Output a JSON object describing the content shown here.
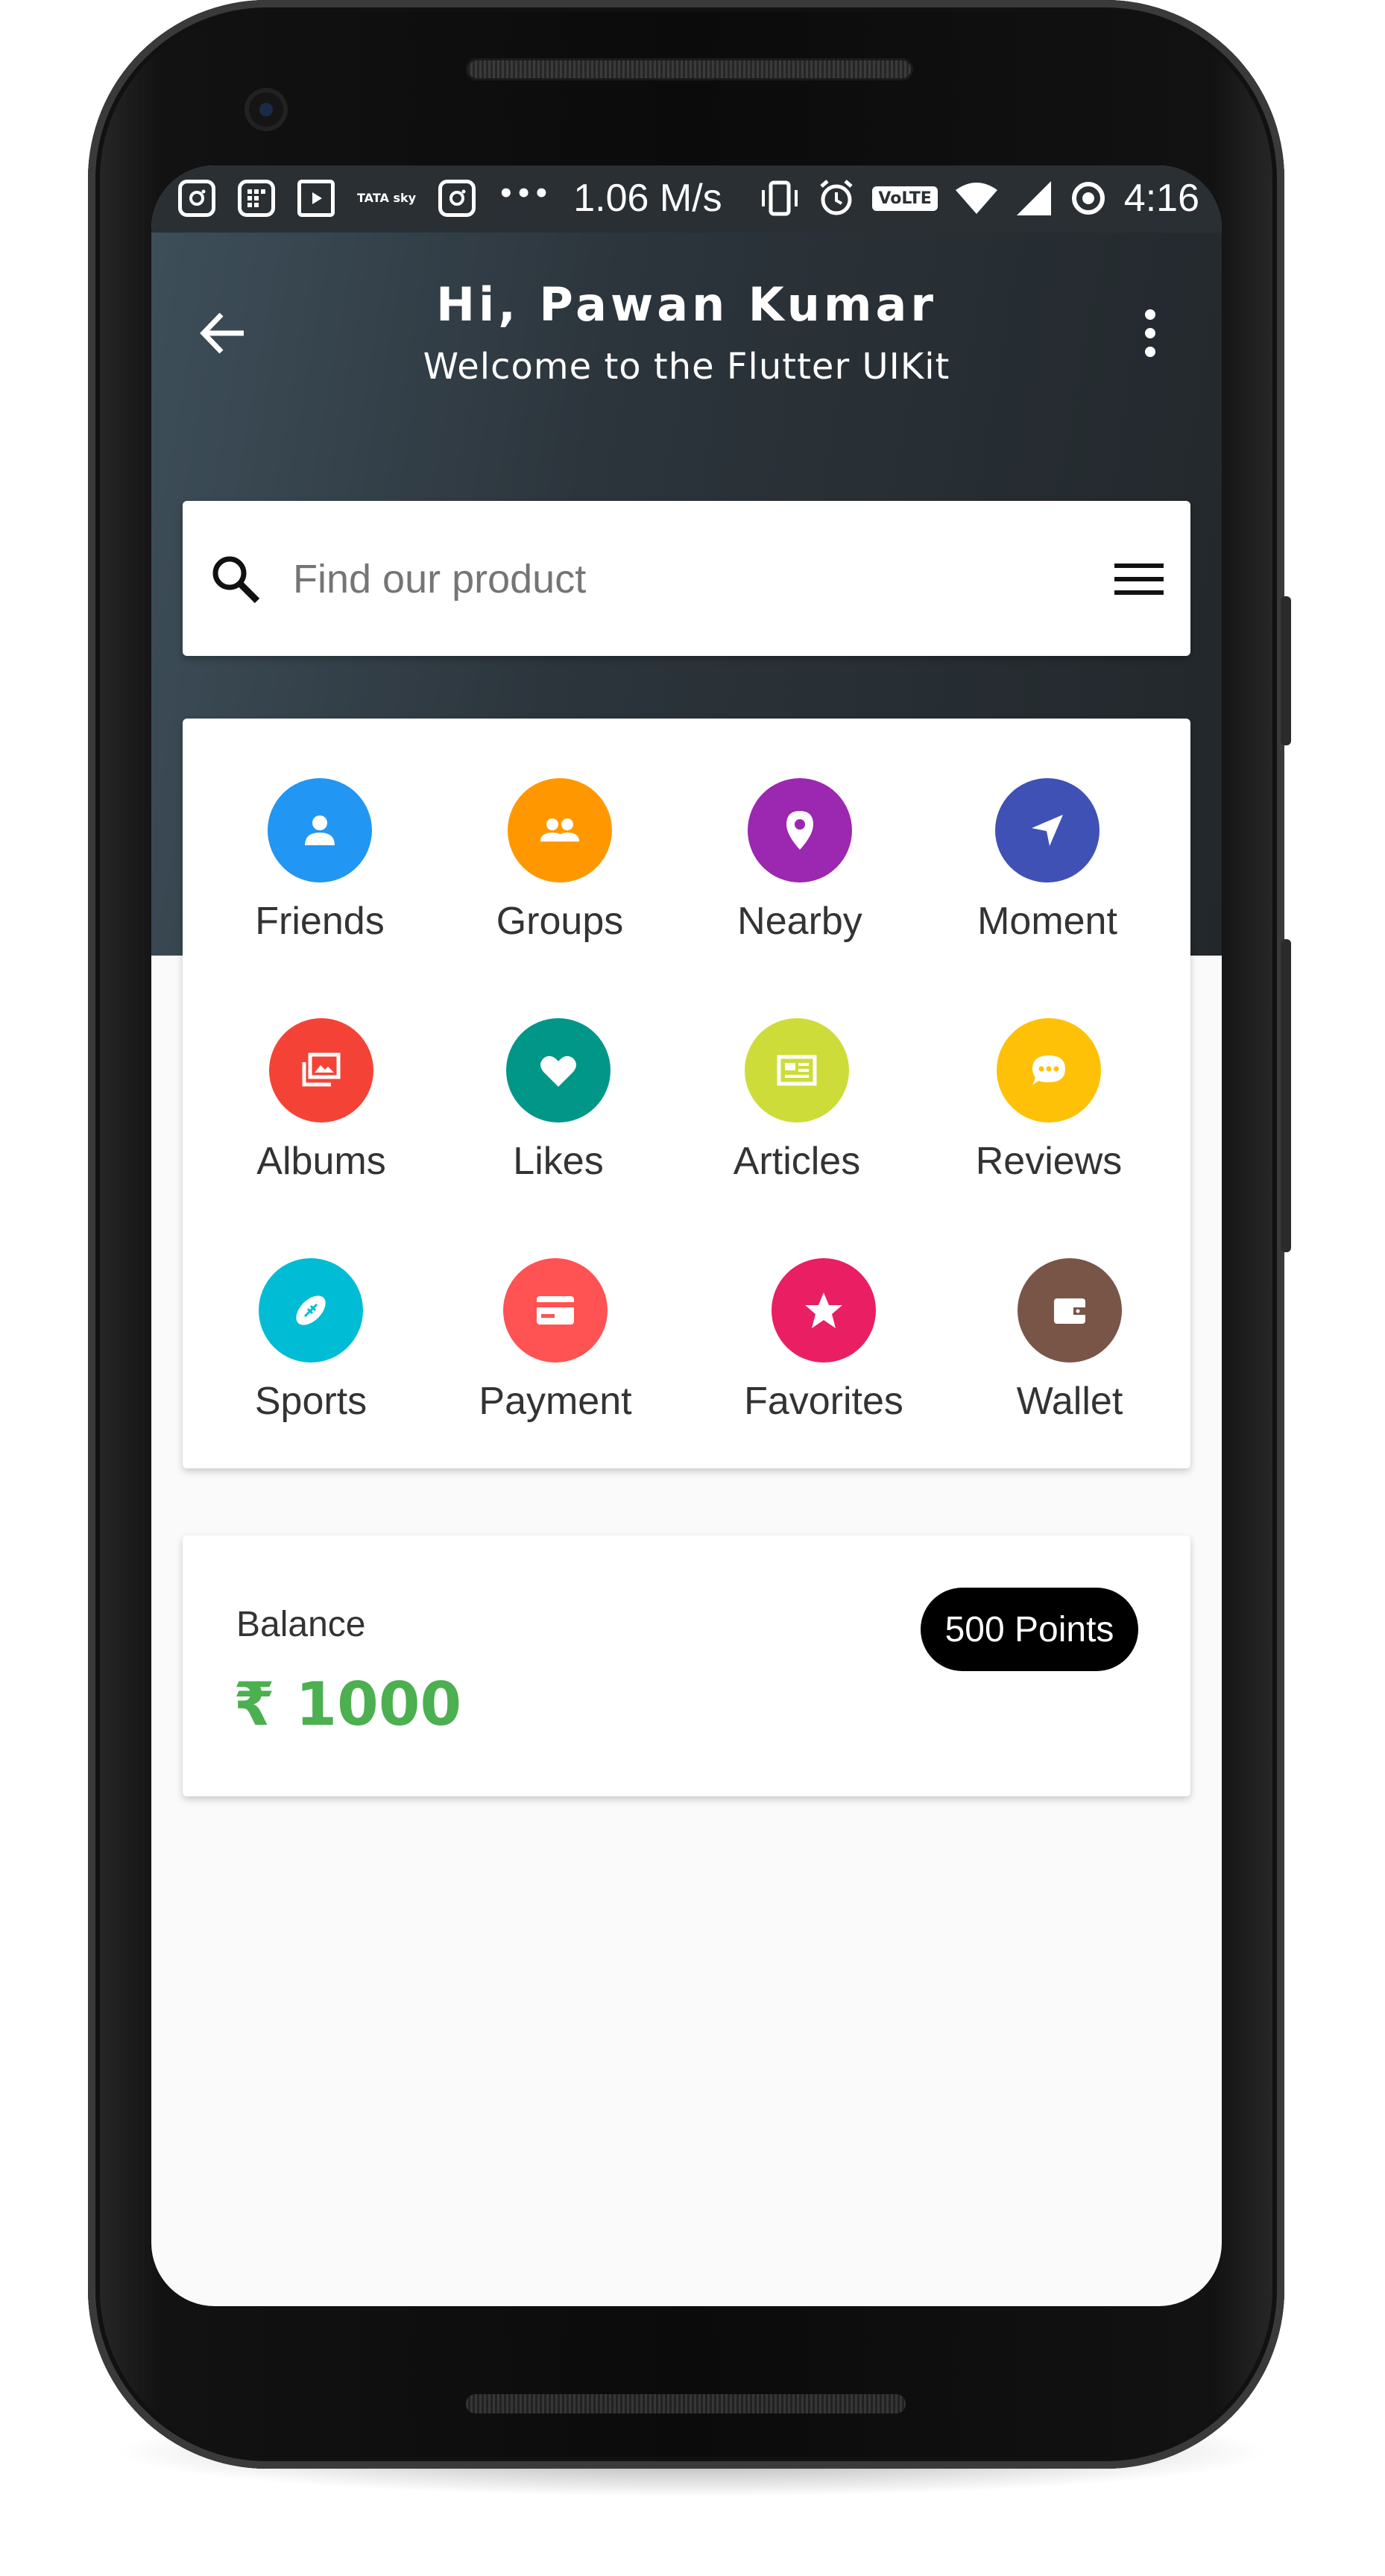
{
  "status_bar": {
    "speed": "1.06 M/s",
    "time": "4:16",
    "network_badge": "VoLTE",
    "provider_badge": "TATA sky",
    "icons": [
      "instagram-icon",
      "grid-app-icon",
      "tv-icon",
      "tata-sky-icon",
      "instagram-icon",
      "more-dots-icon",
      "vibrate-icon",
      "alarm-icon",
      "volte-icon",
      "wifi-icon",
      "signal-icon",
      "sync-icon"
    ]
  },
  "app_bar": {
    "title": "Hi, Pawan Kumar",
    "subtitle": "Welcome to the Flutter UIKit"
  },
  "search": {
    "placeholder": "Find our product"
  },
  "grid": {
    "items": [
      {
        "label": "Friends",
        "color": "#2196f3",
        "icon": "person-icon"
      },
      {
        "label": "Groups",
        "color": "#ff9800",
        "icon": "group-icon"
      },
      {
        "label": "Nearby",
        "color": "#9c27b0",
        "icon": "location-pin-icon"
      },
      {
        "label": "Moment",
        "color": "#3f51b5",
        "icon": "navigation-arrow-icon"
      },
      {
        "label": "Albums",
        "color": "#f44336",
        "icon": "photo-album-icon"
      },
      {
        "label": "Likes",
        "color": "#009688",
        "icon": "heart-icon"
      },
      {
        "label": "Articles",
        "color": "#cddc39",
        "icon": "article-icon"
      },
      {
        "label": "Reviews",
        "color": "#ffc107",
        "icon": "chat-bubble-icon"
      },
      {
        "label": "Sports",
        "color": "#00bcd4",
        "icon": "football-icon"
      },
      {
        "label": "Payment",
        "color": "#ff5252",
        "icon": "credit-card-icon"
      },
      {
        "label": "Favorites",
        "color": "#e91e63",
        "icon": "star-icon"
      },
      {
        "label": "Wallet",
        "color": "#795548",
        "icon": "wallet-icon"
      }
    ]
  },
  "balance": {
    "label": "Balance",
    "value": "₹ 1000",
    "points": "500 Points",
    "value_color": "#4caf50"
  }
}
